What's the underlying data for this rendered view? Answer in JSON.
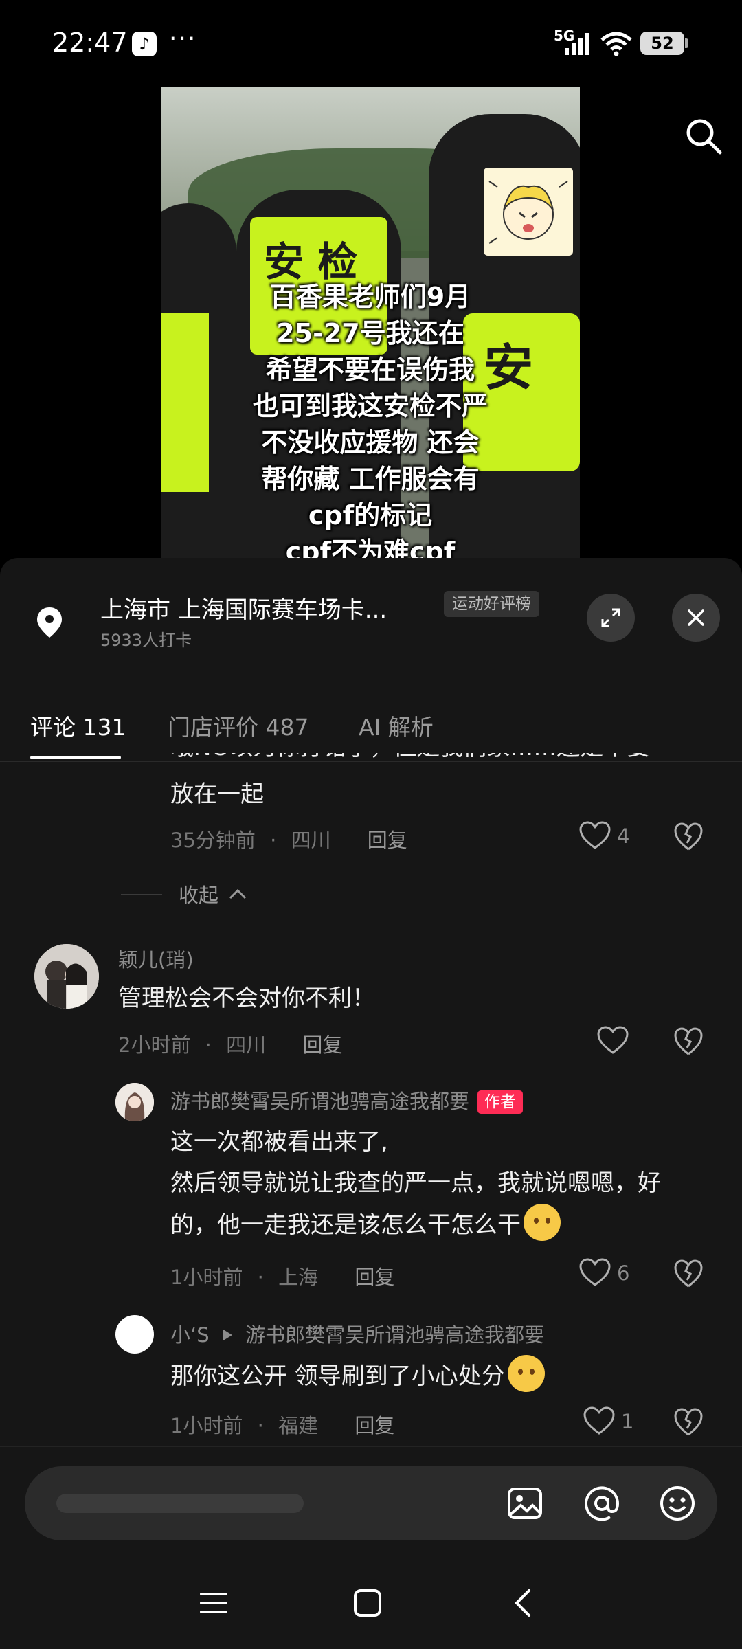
{
  "status_bar": {
    "time": "22:47",
    "network": "5G",
    "battery": "52",
    "more": "···"
  },
  "video": {
    "caption_lines": [
      "百香果老师们9月",
      "25-27号我还在",
      "希望不要在误伤我",
      "也可到我这安检不严",
      "不没收应援物 还会",
      "帮你藏 工作服会有",
      "cpf的标记",
      "cpf不为难cpf"
    ],
    "vest_text_1": "安 检",
    "vest_text_2": "安"
  },
  "location": {
    "title": "上海市  上海国际赛车场卡...",
    "badge": "运动好评榜",
    "subtitle": "5933人打卡"
  },
  "tabs": [
    {
      "label": "评论 131",
      "active": true
    },
    {
      "label": "门店评价 487",
      "active": false
    },
    {
      "label": "AI 解析",
      "active": false
    }
  ],
  "comments": {
    "partial": {
      "cut_text": "哦NO以为你打错了，但是我们家……还是不要",
      "text": "放在一起",
      "time": "35分钟前",
      "region": "四川",
      "reply": "回复",
      "likes": "4"
    },
    "collapse_label": "收起",
    "c1": {
      "name": "颖儿(琑)",
      "text": "管理松会不会对你不利！",
      "time": "2小时前",
      "region": "四川",
      "reply": "回复"
    },
    "r1": {
      "name": "游书郎樊霄吴所谓池骋高途我都要",
      "author_badge": "作者",
      "line1": "这一次都被看出来了,",
      "line2": "然后领导就说让我查的严一点，我就说嗯嗯，好",
      "line3": "的，他一走我还是该怎么干怎么干",
      "time": "1小时前",
      "region": "上海",
      "reply": "回复",
      "likes": "6"
    },
    "r2": {
      "name": "小‘S",
      "reply_to": "游书郎樊霄吴所谓池骋高途我都要",
      "text": "那你这公开 领导刷到了小心处分",
      "time": "1小时前",
      "region": "福建",
      "reply": "回复",
      "likes": "1"
    },
    "separator": "·"
  },
  "colors": {
    "accent": "#fe2c55",
    "sheet": "#161616",
    "vest": "#c8f21e"
  }
}
